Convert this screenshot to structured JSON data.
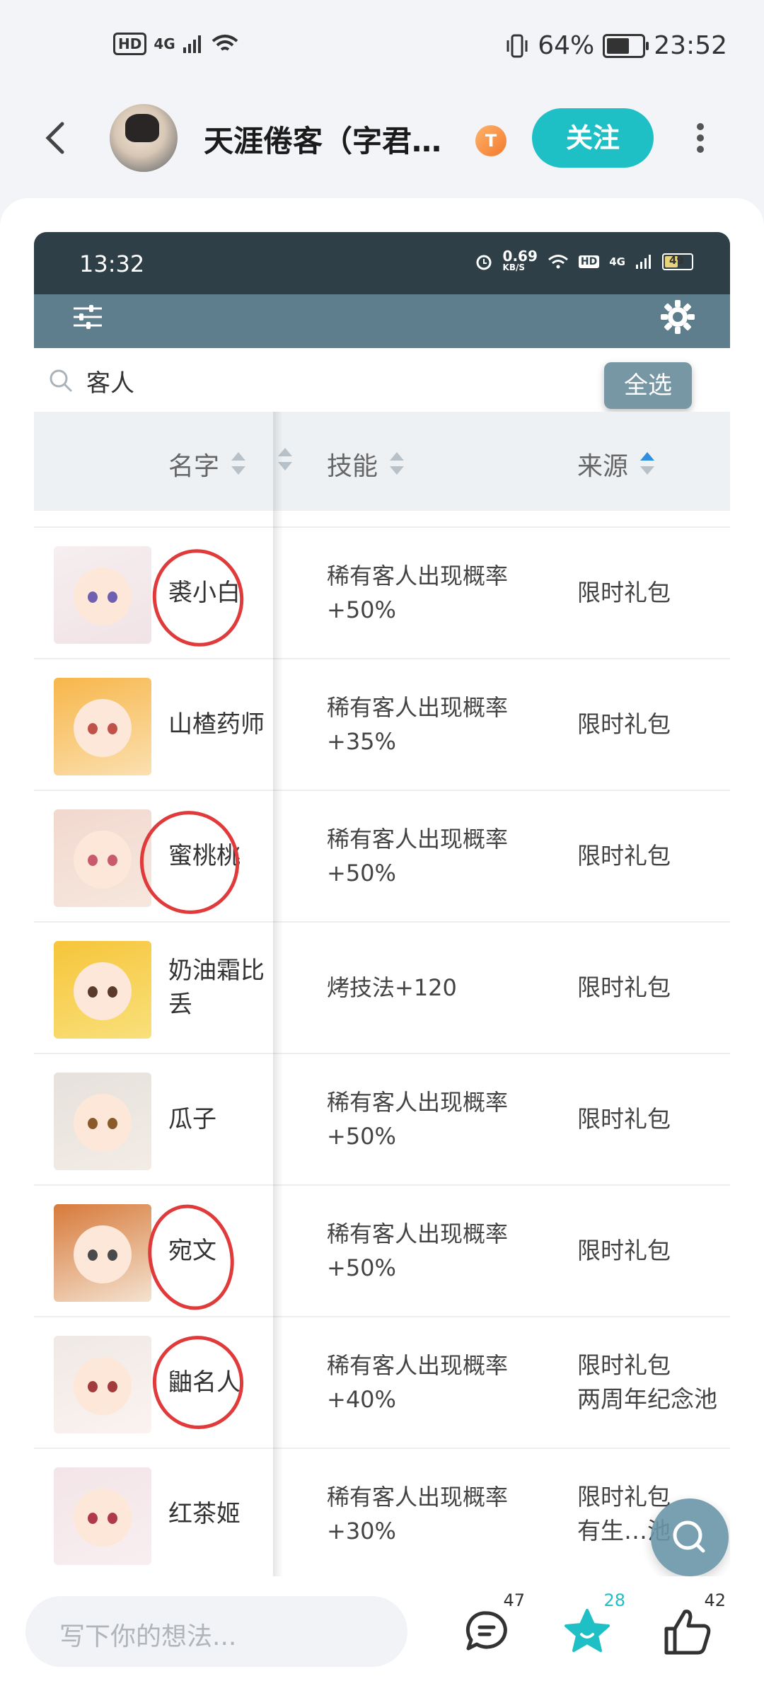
{
  "status_bar": {
    "hd": "HD",
    "net": "4G",
    "battery": "64%",
    "battery_level": 0.64,
    "time": "23:52"
  },
  "header": {
    "user_name": "天涯倦客（字君…",
    "level_badge": "T",
    "follow_label": "关注"
  },
  "screenshot": {
    "status_time": "13:32",
    "net_speed_value": "0.69",
    "net_speed_unit": "KB/S",
    "hd": "HD",
    "net": "4G",
    "battery": "49",
    "battery_level": 0.49,
    "search_text": "客人",
    "select_all_label": "全选",
    "columns": [
      "名字",
      "技能",
      "来源"
    ],
    "rows": [
      {
        "name": "裘小白",
        "skill": "稀有客人出现概率+50%",
        "source": "限时礼包",
        "circled": true
      },
      {
        "name": "山楂药师",
        "skill": "稀有客人出现概率+35%",
        "source": "限时礼包",
        "circled": false
      },
      {
        "name": "蜜桃桃",
        "skill": "稀有客人出现概率+50%",
        "source": "限时礼包",
        "circled": true
      },
      {
        "name": "奶油霜比丢",
        "skill": "烤技法+120",
        "source": "限时礼包",
        "circled": false
      },
      {
        "name": "瓜子",
        "skill": "稀有客人出现概率+50%",
        "source": "限时礼包",
        "circled": false
      },
      {
        "name": "宛文",
        "skill": "稀有客人出现概率+50%",
        "source": "限时礼包",
        "circled": true
      },
      {
        "name": "鼬名人",
        "skill": "稀有客人出现概率+40%",
        "source": "限时礼包\n两周年纪念池",
        "circled": true
      },
      {
        "name": "红茶姬",
        "skill": "稀有客人出现概率+30%",
        "source": "限时礼包\n有生…池",
        "circled": false
      }
    ]
  },
  "bottom_bar": {
    "comment_placeholder": "写下你的想法...",
    "comment_count": "47",
    "star_count": "28",
    "like_count": "42"
  },
  "colors": {
    "accent": "#1ec0c6",
    "screenshot_header": "#5f7e8d",
    "circle_mark": "#e03a3a"
  }
}
